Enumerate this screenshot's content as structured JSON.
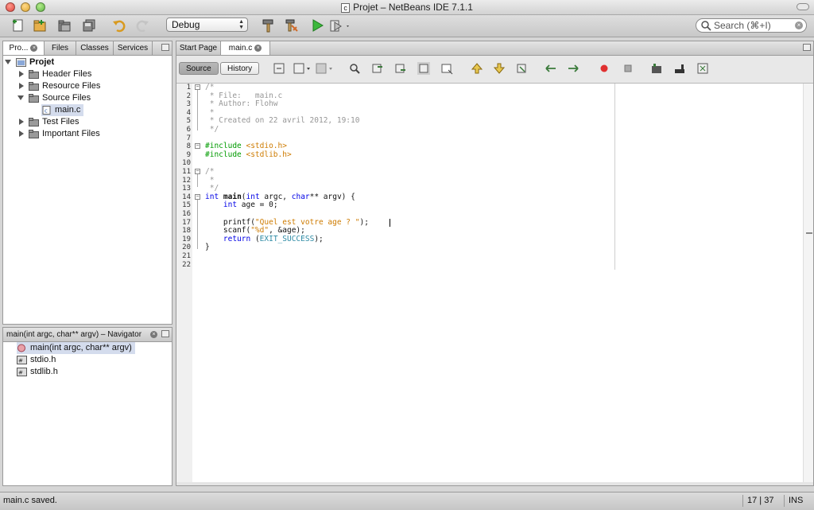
{
  "window": {
    "title": "Projet – NetBeans IDE 7.1.1",
    "title_icon_glyph": "c"
  },
  "toolbar": {
    "config": "Debug",
    "search_placeholder": "Search (⌘+I)",
    "icons": [
      "new-file-icon",
      "new-project-icon",
      "open-project-icon",
      "save-all-icon",
      "undo-icon",
      "redo-icon",
      "build-hammer-icon",
      "clean-build-icon",
      "run-icon",
      "debug-icon"
    ]
  },
  "projects": {
    "tabs": [
      {
        "label": "Pro...",
        "active": true
      },
      {
        "label": "Files",
        "active": false
      },
      {
        "label": "Classes",
        "active": false
      },
      {
        "label": "Services",
        "active": false
      }
    ],
    "tree": {
      "root": "Projet",
      "items": [
        {
          "label": "Header Files"
        },
        {
          "label": "Resource Files"
        },
        {
          "label": "Source Files"
        },
        {
          "label": "main.c"
        },
        {
          "label": "Test Files"
        },
        {
          "label": "Important Files"
        }
      ]
    }
  },
  "navigator": {
    "title": "main(int argc, char** argv) – Navigator",
    "items": [
      {
        "label": "main(int argc, char** argv)"
      },
      {
        "label": "stdio.h"
      },
      {
        "label": "stdlib.h"
      }
    ]
  },
  "editor": {
    "tabs": [
      {
        "label": "Start Page"
      },
      {
        "label": "main.c"
      }
    ],
    "source_label": "Source",
    "history_label": "History",
    "line_numbers": [
      "1",
      "2",
      "3",
      "4",
      "5",
      "6",
      "7",
      "8",
      "9",
      "10",
      "11",
      "12",
      "13",
      "14",
      "15",
      "16",
      "17",
      "18",
      "19",
      "20",
      "21",
      "22"
    ],
    "code": {
      "l1": "/*",
      "l2": " * File:   main.c",
      "l3": " * Author: Flohw",
      "l4": " *",
      "l5": " * Created on 22 avril 2012, 19:10",
      "l6": " */",
      "l8_kw": "#include ",
      "l8_str": "<stdio.h>",
      "l9_kw": "#include ",
      "l9_str": "<stdlib.h>",
      "l11": "/*",
      "l12": " *",
      "l13": " */",
      "l14_a": "int",
      "l14_b": " ",
      "l14_c": "main",
      "l14_d": "(",
      "l14_e": "int",
      "l14_f": " argc, ",
      "l14_g": "char",
      "l14_h": "** argv) {",
      "l15_a": "    ",
      "l15_b": "int",
      "l15_c": " age = 0;",
      "l17_a": "    printf(",
      "l17_b": "\"Quel est votre age ? \"",
      "l17_c": ");",
      "l18_a": "    scanf(",
      "l18_b": "\"%d\"",
      "l18_c": ", &age);",
      "l19_a": "    ",
      "l19_b": "return",
      "l19_c": " (",
      "l19_d": "EXIT_SUCCESS",
      "l19_e": ");",
      "l20": "}"
    }
  },
  "status": {
    "message": "main.c saved.",
    "position": "17 | 37",
    "mode": "INS"
  },
  "colors": {
    "keyword": "#0000e6",
    "comment": "#969696",
    "preprocessor": "#009b00",
    "string": "#ce7b00"
  }
}
